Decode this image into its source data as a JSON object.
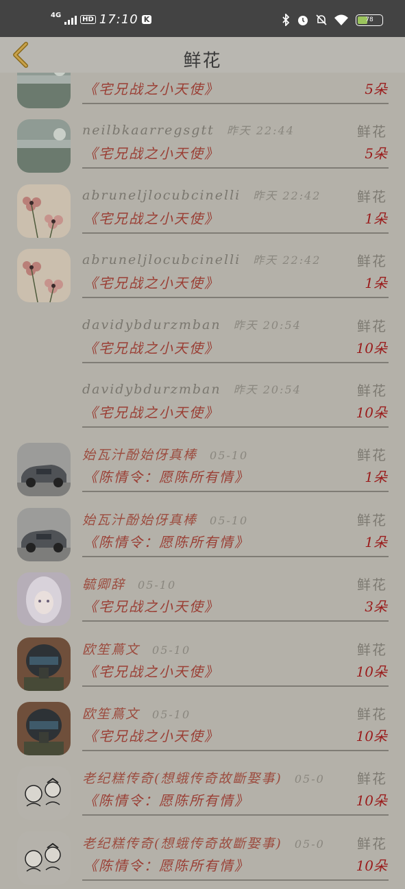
{
  "status_bar": {
    "network": "4G",
    "hd": "HD",
    "time": "17:10",
    "app_badge": "K",
    "battery": "78"
  },
  "header": {
    "title": "鲜花"
  },
  "rows": [
    {
      "name": "",
      "time": "",
      "gift_type": "",
      "work": "《宅兄战之小天使》",
      "count": "5朵",
      "avatar": "photo-landscape",
      "name_color": "gray"
    },
    {
      "name": "neilbkaarregsgtt",
      "time": "昨天 22:44",
      "gift_type": "鲜花",
      "work": "《宅兄战之小天使》",
      "count": "5朵",
      "avatar": "photo-landscape",
      "name_color": "gray"
    },
    {
      "name": "abruneljlocubcinelli",
      "time": "昨天 22:42",
      "gift_type": "鲜花",
      "work": "《宅兄战之小天使》",
      "count": "1朵",
      "avatar": "flowers",
      "name_color": "gray"
    },
    {
      "name": "abruneljlocubcinelli",
      "time": "昨天 22:42",
      "gift_type": "鲜花",
      "work": "《宅兄战之小天使》",
      "count": "1朵",
      "avatar": "flowers",
      "name_color": "gray"
    },
    {
      "name": "davidybdurzmban",
      "time": "昨天 20:54",
      "gift_type": "鲜花",
      "work": "《宅兄战之小天使》",
      "count": "10朵",
      "avatar": "none",
      "name_color": "gray"
    },
    {
      "name": "davidybdurzmban",
      "time": "昨天 20:54",
      "gift_type": "鲜花",
      "work": "《宅兄战之小天使》",
      "count": "10朵",
      "avatar": "none",
      "name_color": "gray"
    },
    {
      "name": "始瓦汁酚始伢真棒",
      "time": "05-10",
      "gift_type": "鲜花",
      "work": "《陈情令：愿陈所有情》",
      "count": "1朵",
      "avatar": "car",
      "name_color": "red"
    },
    {
      "name": "始瓦汁酚始伢真棒",
      "time": "05-10",
      "gift_type": "鲜花",
      "work": "《陈情令：愿陈所有情》",
      "count": "1朵",
      "avatar": "car",
      "name_color": "red"
    },
    {
      "name": "毓卿辞",
      "time": "05-10",
      "gift_type": "鲜花",
      "work": "《宅兄战之小天使》",
      "count": "3朵",
      "avatar": "anime-girl",
      "name_color": "red"
    },
    {
      "name": "欧笙蔦文",
      "time": "05-10",
      "gift_type": "鲜花",
      "work": "《宅兄战之小天使》",
      "count": "10朵",
      "avatar": "pilot",
      "name_color": "red"
    },
    {
      "name": "欧笙蔦文",
      "time": "05-10",
      "gift_type": "鲜花",
      "work": "《宅兄战之小天使》",
      "count": "10朵",
      "avatar": "pilot",
      "name_color": "red"
    },
    {
      "name": "老纪糕传奇(想蛾传奇故斷娶事)",
      "time": "05-0",
      "gift_type": "鲜花",
      "work": "《陈情令：愿陈所有情》",
      "count": "10朵",
      "avatar": "cartoon-kids",
      "name_color": "red"
    },
    {
      "name": "老纪糕传奇(想蛾传奇故斷娶事)",
      "time": "05-0",
      "gift_type": "鲜花",
      "work": "《陈情令：愿陈所有情》",
      "count": "10朵",
      "avatar": "cartoon-kids",
      "name_color": "red"
    }
  ]
}
